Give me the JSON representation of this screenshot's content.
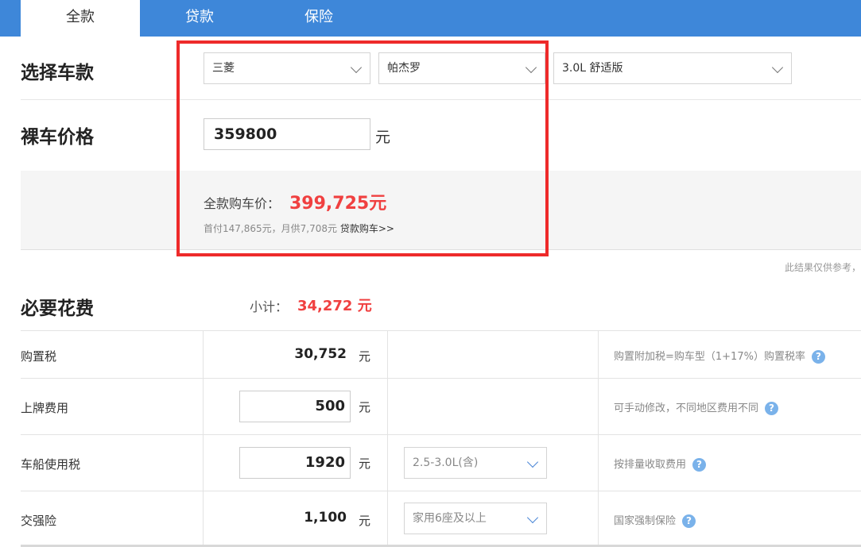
{
  "tabs": [
    {
      "label": "全款",
      "active": true
    },
    {
      "label": "贷款",
      "active": false
    },
    {
      "label": "保险",
      "active": false
    }
  ],
  "select_car": {
    "heading": "选择车款",
    "brand": "三菱",
    "series": "帕杰罗",
    "model": "3.0L 舒适版"
  },
  "bare_price": {
    "heading": "裸车价格",
    "value": "359800",
    "unit": "元"
  },
  "summary": {
    "total_label": "全款购车价：",
    "total_value": "399,725元",
    "sub_text": "首付147,865元，月供7,708元",
    "loan_link": "贷款购车>>"
  },
  "note": "此结果仅供参考，",
  "required_fees": {
    "heading": "必要花费",
    "subtotal_label": "小计：",
    "subtotal_value": "34,272 元",
    "rows": [
      {
        "label": "购置税",
        "value": "30,752",
        "unit": "元",
        "note": "购置附加税=购车型（1+17%）购置税率"
      },
      {
        "label": "上牌费用",
        "value": "500",
        "unit": "元",
        "note": "可手动修改，不同地区费用不同"
      },
      {
        "label": "车船使用税",
        "value": "1920",
        "unit": "元",
        "select": "2.5-3.0L(含)",
        "note": "按排量收取费用"
      },
      {
        "label": "交强险",
        "value": "1,100",
        "unit": "元",
        "select": "家用6座及以上",
        "note": "国家强制保险"
      }
    ]
  },
  "colors": {
    "tab_bar": "#3e87d9",
    "price_red": "#f04040",
    "highlight_red": "#ee2a2a",
    "help_blue": "#7ab2ea"
  },
  "icons": {
    "dropdown": "chevron-down-icon",
    "help": "question-mark-icon"
  }
}
